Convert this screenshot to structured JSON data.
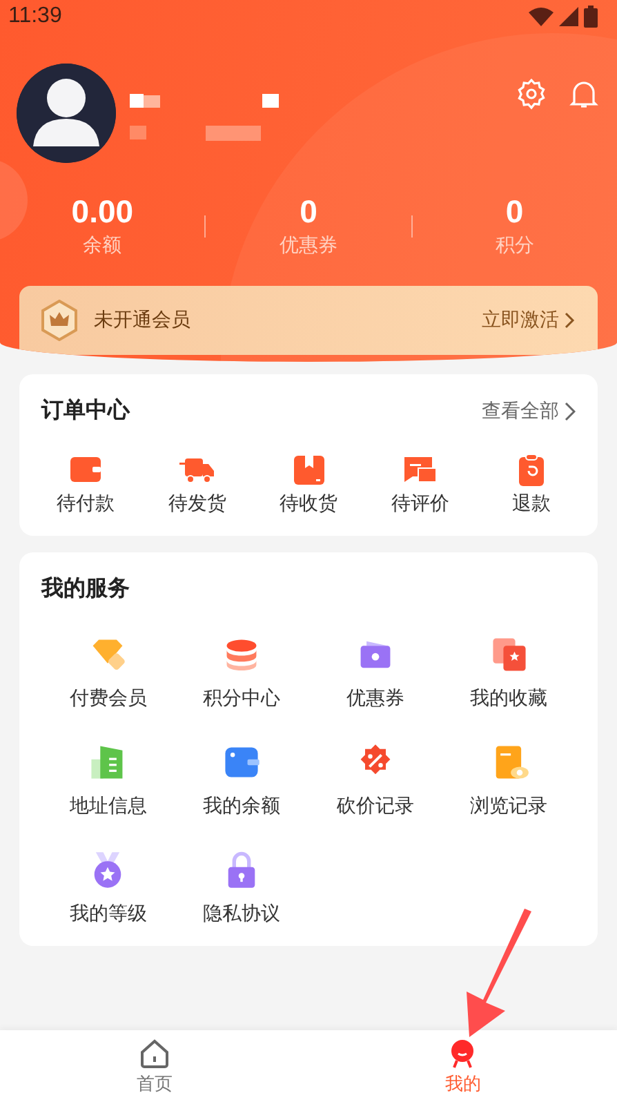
{
  "status_bar": {
    "time": "11:39"
  },
  "stats": [
    {
      "value": "0.00",
      "label": "余额"
    },
    {
      "value": "0",
      "label": "优惠券"
    },
    {
      "value": "0",
      "label": "积分"
    }
  ],
  "member_banner": {
    "text": "未开通会员",
    "action": "立即激活"
  },
  "orders": {
    "title": "订单中心",
    "more": "查看全部",
    "items": [
      "待付款",
      "待发货",
      "待收货",
      "待评价",
      "退款"
    ]
  },
  "services": {
    "title": "我的服务",
    "items": [
      "付费会员",
      "积分中心",
      "优惠券",
      "我的收藏",
      "地址信息",
      "我的余额",
      "砍价记录",
      "浏览记录",
      "我的等级",
      "隐私协议"
    ]
  },
  "tab_bar": [
    {
      "label": "首页",
      "selected": false
    },
    {
      "label": "我的",
      "selected": true
    }
  ]
}
